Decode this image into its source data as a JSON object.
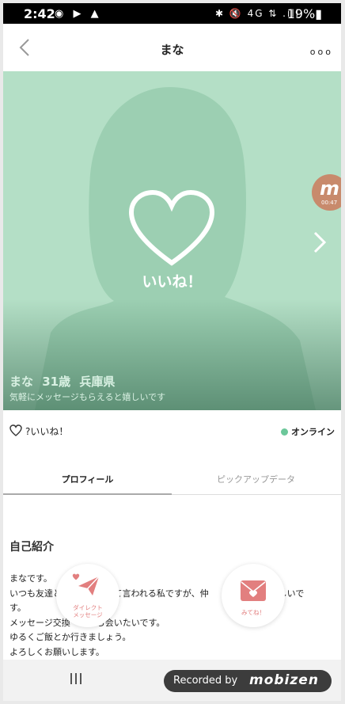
{
  "status_bar": {
    "time": "2:42",
    "left_icons": "◉ ▶ ▲",
    "right_icons": "✱ 🔇 4G ⇅ .ıll",
    "battery": "19%▮"
  },
  "header": {
    "title": "まな",
    "more": "ooo"
  },
  "photo": {
    "like_overlay": "いいね！",
    "name_line": "まな 31歳 兵庫県",
    "message": "気軽にメッセージもらえると嬉しいです",
    "recording_bubble": {
      "logo": "m",
      "timer": "00:47"
    }
  },
  "likes": {
    "label": "?いいね！",
    "online_label": "オンライン"
  },
  "tabs": [
    "プロフィール",
    "ピックアップデータ"
  ],
  "profile": {
    "section_title": "自己紹介",
    "bio": [
      "まなです。",
      "いつも友達と　　　　　って言われる私ですが、仲　　　　　　ら嬉しいで",
      "す。",
      "メッセージ交換　　　ら会いたいです。",
      "ゆるくご飯とか行きましょう。",
      "よろしくお願いします。"
    ]
  },
  "actions": {
    "direct_message": [
      "ダイレクト",
      "メッセージ"
    ],
    "mitene": "みてね！"
  },
  "nav_bar": {
    "recents": "|||",
    "recorded_by": "Recorded by",
    "recorder_brand": "mobizen"
  },
  "colors": {
    "photo_bg": "#b4dfc6",
    "silhouette": "#9ccfb2",
    "accent_pink": "#e27f7f",
    "online_green": "#6cc79a"
  }
}
